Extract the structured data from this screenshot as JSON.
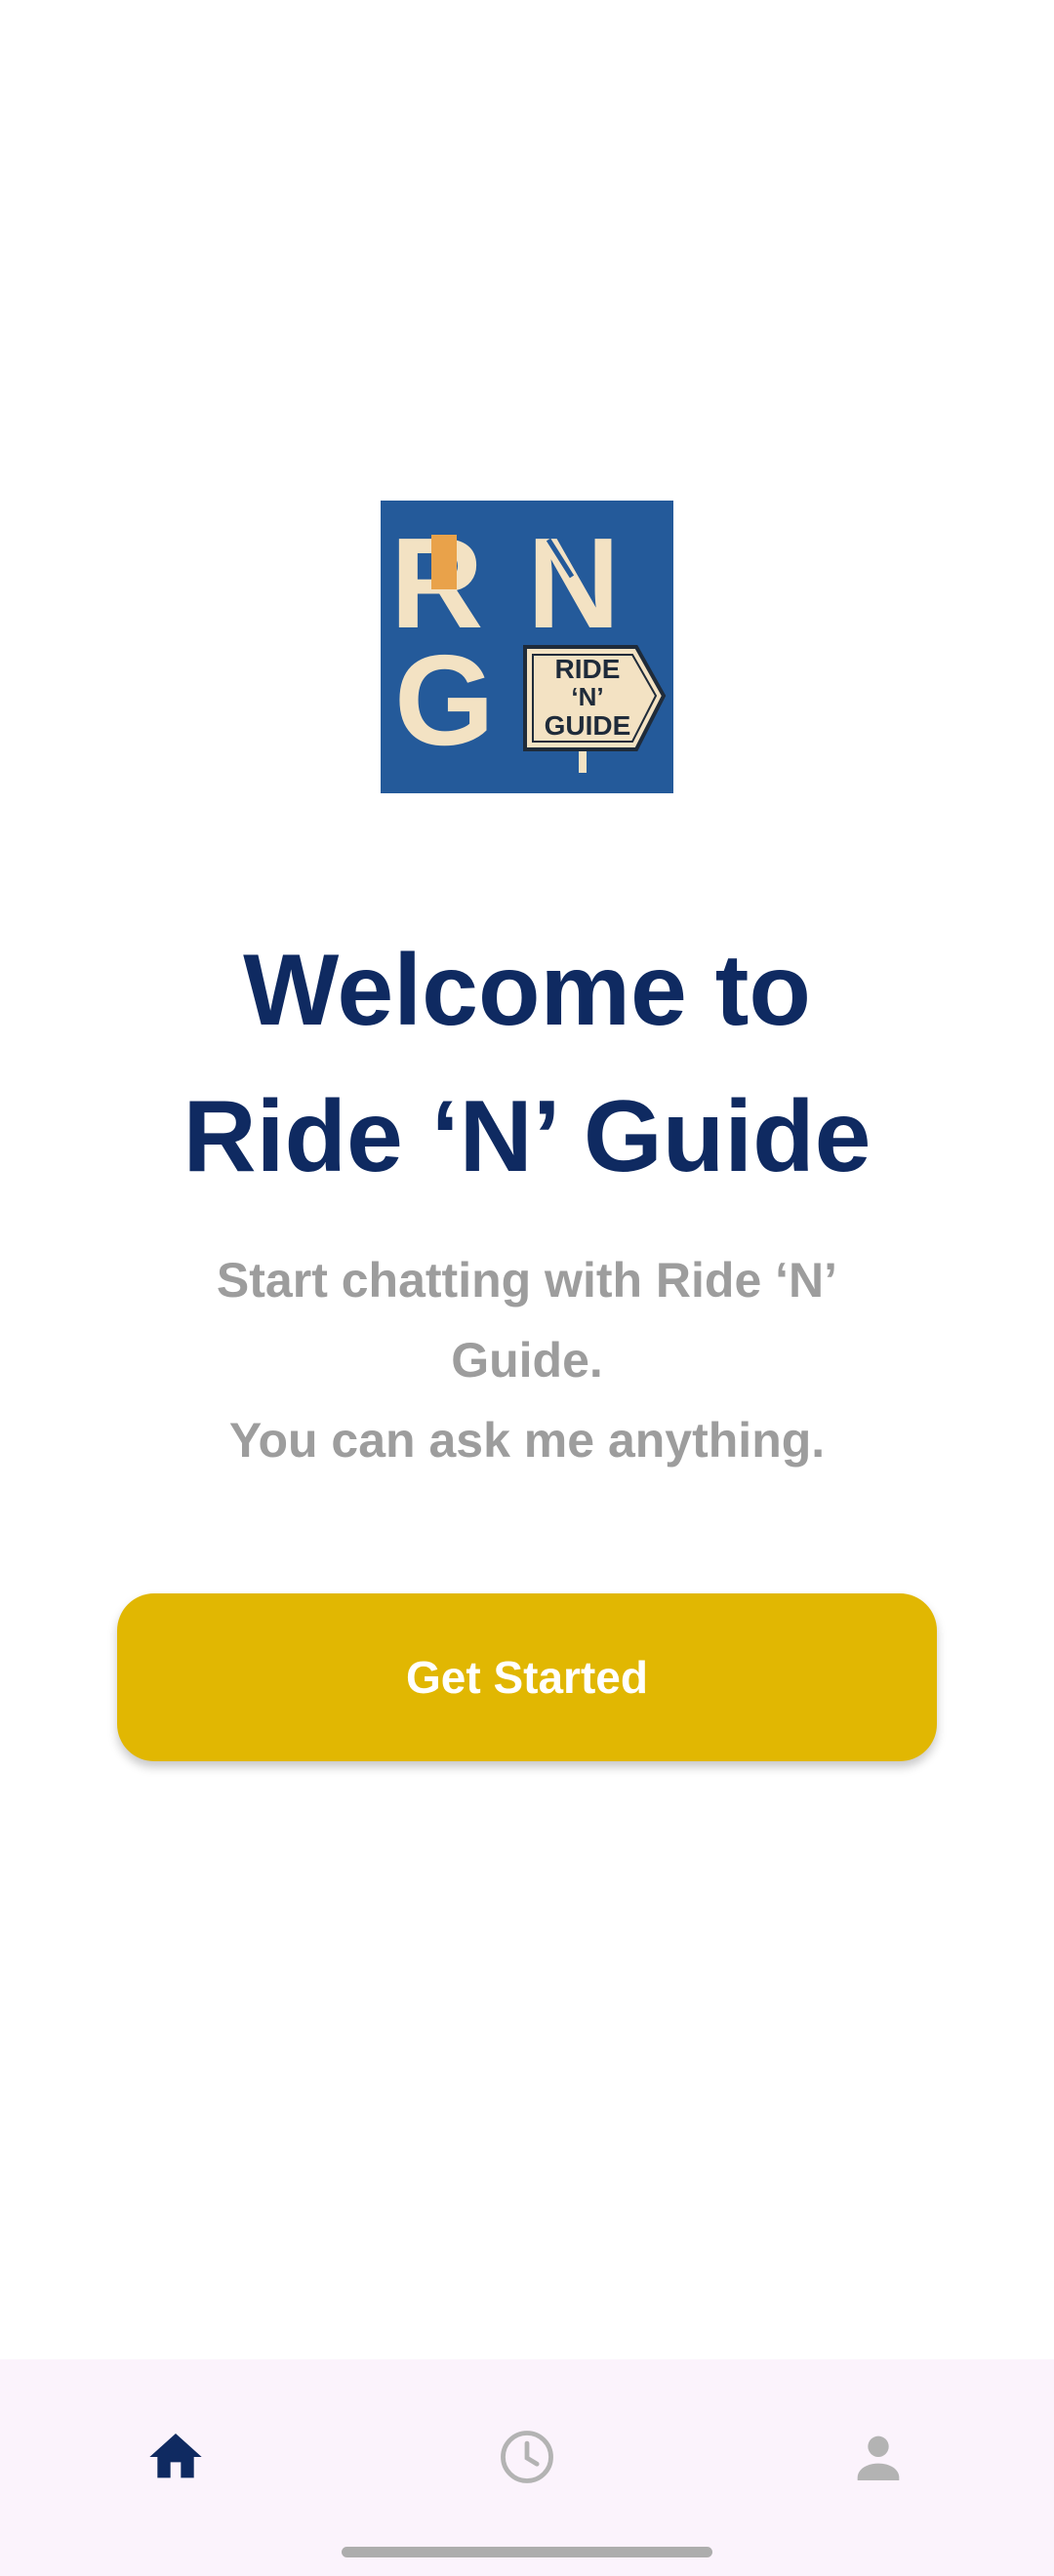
{
  "logo": {
    "alt": "Ride 'N' Guide logo",
    "letters": [
      "R",
      "N",
      "G"
    ],
    "sign_lines": [
      "RIDE",
      "‘N’",
      "GUIDE"
    ],
    "colors": {
      "background": "#245a9a",
      "letters": "#f3e2c3",
      "accent": "#e9a24a",
      "ink": "#1f2b3a"
    }
  },
  "welcome": {
    "title_line1": "Welcome to",
    "title_line2": "Ride ‘N’ Guide",
    "subtitle_line1": "Start chatting with Ride ‘N’",
    "subtitle_line2": "Guide.",
    "subtitle_line3": "You can ask me anything."
  },
  "cta": {
    "label": "Get Started"
  },
  "bottom_nav": {
    "items": [
      {
        "name": "home",
        "icon": "home-icon",
        "active": true
      },
      {
        "name": "history",
        "icon": "clock-icon",
        "active": false
      },
      {
        "name": "profile",
        "icon": "person-icon",
        "active": false
      }
    ]
  },
  "colors": {
    "title": "#0f2a61",
    "subtitle": "#9d9d9d",
    "button": "#e1b702",
    "button_text": "#ffffff",
    "nav_background": "#fbf3fc",
    "nav_active": "#0f2a61",
    "nav_inactive": "#b3b3b3"
  }
}
